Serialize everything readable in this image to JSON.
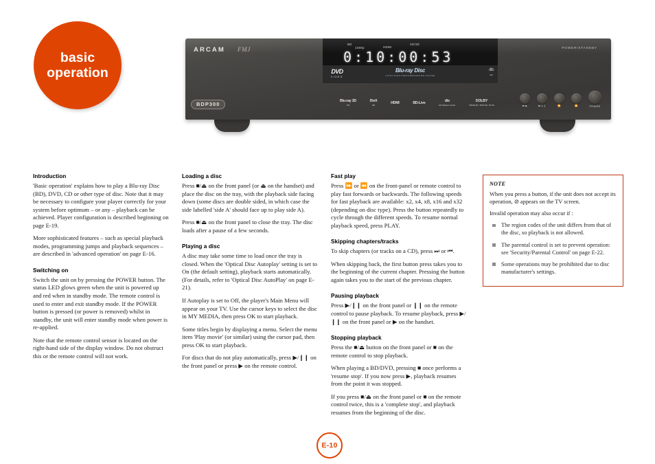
{
  "chapter": {
    "line1": "basic",
    "line2": "operation",
    "color": "#e04403"
  },
  "device": {
    "brand": "ARCAM",
    "sub_brand": "FMJ",
    "model_badge": "BDP300",
    "standby_label": "POWER/STANDBY",
    "display": {
      "flags": [
        "BD",
        "1080p",
        "HDMI",
        "2D/3D"
      ],
      "readout": "0:10:00:53",
      "disc_logos": {
        "left_title": "DVD",
        "left_sub": "VIDEO",
        "center_title": "Blu-ray Disc",
        "center_sub": "ULTRA HIGH PERFORMANCE BD PLAYER",
        "right_title": "dts",
        "right_sub": "HD"
      }
    },
    "format_logos": [
      {
        "name": "Blu-ray 3D",
        "sub": "TM"
      },
      {
        "name": "DivX",
        "sub": "HD"
      },
      {
        "name": "HDMI",
        "sub": ""
      },
      {
        "name": "BD-Live",
        "sub": ""
      },
      {
        "name": "dts",
        "sub": "HD Master Audio"
      },
      {
        "name": "DOLBY",
        "sub": "TRUEHD / DIGITAL PLUS"
      }
    ],
    "buttons": [
      {
        "label": "■/⏏"
      },
      {
        "label": "▶/❙❙"
      },
      {
        "label": "⏪"
      },
      {
        "label": "⏩"
      },
      {
        "label": "POWER"
      }
    ]
  },
  "columns": {
    "col1": [
      {
        "type": "h",
        "text": "Introduction"
      },
      {
        "type": "p",
        "text": "'Basic operation' explains how to play a Blu-ray Disc (BD), DVD, CD or other type of disc. Note that it may be necessary to configure your player correctly for your system before optimum – or any – playback can be achieved. Player configuration is described beginning on page E-19."
      },
      {
        "type": "p",
        "text": "More sophisticated features – such as special playback modes, programming jumps and playback sequences – are described in 'advanced operation' on page E-16."
      },
      {
        "type": "h",
        "text": "Switching on"
      },
      {
        "type": "p",
        "text": "Switch the unit on by pressing the POWER button. The status LED glows green when the unit is powered up and red when in standby mode. The remote control is used to enter and exit standby mode. If the POWER button is pressed (or power is removed) whilst in standby, the unit will enter standby mode when power is re-applied."
      },
      {
        "type": "p",
        "text": "Note that the remote control sensor is located on the right-hand side of the display window. Do not obstruct this or the remote control will not work."
      }
    ],
    "col2": [
      {
        "type": "h",
        "text": "Loading a disc"
      },
      {
        "type": "p",
        "text": "Press ■/⏏ on the front panel (or ⏏ on the handset) and place the disc on the tray, with the playback side facing down (some discs are double sided, in which case the side labelled 'side A' should face up to play side A)."
      },
      {
        "type": "p",
        "text": "Press ■/⏏ on the front panel to close the tray. The disc loads after a pause of a few seconds."
      },
      {
        "type": "h",
        "text": "Playing a disc"
      },
      {
        "type": "p",
        "text": "A disc may take some time to load once the tray is closed. When the 'Optical Disc Autoplay' setting is set to On (the default setting), playback starts automatically. (For details, refer to 'Optical Disc AutoPlay' on page E-21)."
      },
      {
        "type": "p",
        "text": "If Autoplay is set to Off, the player's Main Menu will appear on your TV. Use the cursor keys to select the disc in MY MEDIA, then press OK to start playback."
      },
      {
        "type": "p",
        "text": "Some titles begin by displaying a menu. Select the menu item 'Play movie' (or similar) using the cursor pad, then press OK to start playback."
      },
      {
        "type": "p",
        "text": "For discs that do not play automatically, press ▶/❙❙ on the front panel or press ▶ on the remote control."
      }
    ],
    "col3": [
      {
        "type": "h",
        "text": "Fast play"
      },
      {
        "type": "p",
        "text": "Press ⏩ or ⏪ on the front-panel or remote control to play fast forwards or backwards. The following speeds for fast playback are available: x2, x4, x8, x16 and x32 (depending on disc type). Press the button repeatedly to cycle through the different speeds. To resume normal playback speed, press PLAY."
      },
      {
        "type": "h",
        "text": "Skipping chapters/tracks"
      },
      {
        "type": "p",
        "text": "To skip chapters (or tracks on a CD), press ⏭ or ⏮."
      },
      {
        "type": "p",
        "text": "When skipping back, the first button press takes you to the beginning of the current chapter. Pressing the button again takes you to the start of the previous chapter."
      },
      {
        "type": "h",
        "text": "Pausing playback"
      },
      {
        "type": "p",
        "text": "Press ▶/❙❙ on the front panel or ❙❙ on the remote control to pause playback. To resume playback, press ▶/❙❙ on the front panel or ▶ on the handset."
      },
      {
        "type": "h",
        "text": "Stopping playback"
      },
      {
        "type": "p",
        "text": "Press the ■/⏏ button on the front panel or ■ on the remote control to stop playback."
      },
      {
        "type": "p",
        "text": "When playing a BD/DVD, pressing ■ once performs a 'resume stop'. If you now press ▶, playback resumes from the point it was stopped."
      },
      {
        "type": "p",
        "text": "If you press ■/⏏ on the front panel or ■ on the remote control twice, this is a 'complete stop', and playback resumes from the beginning of the disc."
      }
    ]
  },
  "note": {
    "title": "NOTE",
    "paragraph1": "When you press a button, if the unit does not accept its operation, ⊘ appears on the TV screen.",
    "paragraph2": "Invalid operation may also occur if :",
    "bullets": [
      "The region codes of the unit differs from that of the disc, so playback is not allowed.",
      "The parental control is set to prevent operation: see 'Security/Parental Control' on page E-22.",
      "Some operations may be prohibited due to disc manufacturer's settings."
    ],
    "border_color": "#c0381a"
  },
  "page_number": "E-10"
}
